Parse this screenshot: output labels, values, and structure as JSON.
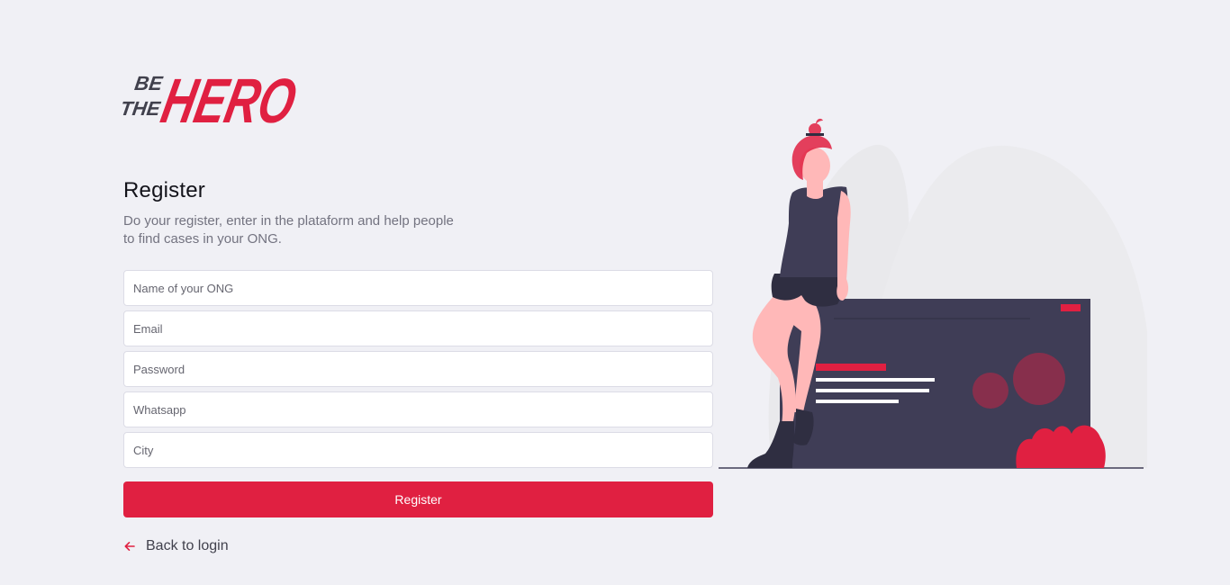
{
  "brand": {
    "logo_text_be": "BE",
    "logo_text_the": "THE",
    "logo_text_hero": "HERO",
    "accent_color": "#e02041",
    "dark_color": "#41414d"
  },
  "register": {
    "title": "Register",
    "description": "Do your register, enter in the plataform and help people to find cases in your ONG."
  },
  "form": {
    "name_placeholder": "Name of your ONG",
    "email_placeholder": "Email",
    "password_placeholder": "Password",
    "whatsapp_placeholder": "Whatsapp",
    "city_placeholder": "City",
    "submit_label": "Register"
  },
  "back_link": {
    "label": "Back to login",
    "icon": "arrow-left-icon"
  },
  "illustration": {
    "name": "woman-sitting-on-screen-illustration"
  }
}
